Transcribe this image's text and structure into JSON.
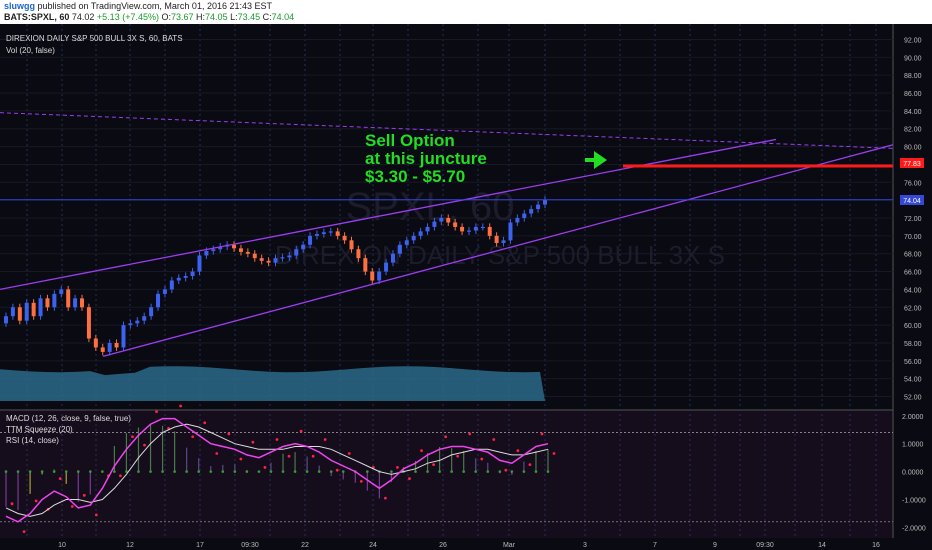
{
  "header": {
    "username": "sluwgg",
    "published_text": "published on TradingView.com, March 01, 2016 21:43 EST",
    "symbol_interval": "BATS:SPXL, 60",
    "last": "74.02",
    "change": "+5.13 (+7.45%)",
    "open_label": "O:",
    "open": "73.67",
    "high_label": "H:",
    "high": "74.05",
    "low_label": "L:",
    "low": "73.45",
    "close_label": "C:",
    "close": "74.04"
  },
  "chart_labels": {
    "title": "DIREXION DAILY S&P 500 BULL 3X S, 60, BATS",
    "volume": "Vol (20, false)",
    "watermark_symbol": "SPXL, 60",
    "watermark_name": "DIREXION DAILY S&P 500 BULL 3X S",
    "macd": "MACD (12, 26, close, 9, false, true)",
    "squeeze": "TTM Squeeze (20)",
    "rsi": "RSI (14, close)",
    "current_price": "74.04",
    "target_price": "77.83"
  },
  "annotation": {
    "line1": "Sell Option",
    "line2": "at this juncture",
    "line3": "$3.30 - $5.70",
    "color": "#22dd22"
  },
  "colors": {
    "background": "#0a0a12",
    "up_candle": "#3e62f0",
    "down_candle": "#ff7040",
    "channel": "#9b3ef0",
    "target": "#ff1a1a",
    "macd": "#ee44ee",
    "signal": "#dddddd",
    "dots": "#ff2244",
    "volume": "#2a6a8a"
  },
  "chart_data": [
    {
      "type": "candlestick",
      "title": "DIREXION DAILY S&P 500 BULL 3X S, 60, BATS",
      "y_ticks": [
        "52.00",
        "54.00",
        "56.00",
        "58.00",
        "60.00",
        "62.00",
        "64.00",
        "66.00",
        "68.00",
        "70.00",
        "72.00",
        "74.00",
        "76.00",
        "78.00",
        "80.00",
        "82.00",
        "84.00",
        "86.00",
        "88.00",
        "90.00",
        "92.00"
      ],
      "ylim": [
        51.5,
        92.5
      ],
      "x_ticks": [
        "10",
        "12",
        "17",
        "09:30",
        "22",
        "24",
        "26",
        "Mar",
        "3",
        "7",
        "9",
        "09:30",
        "14",
        "16"
      ],
      "close_series": [
        61.0,
        62.0,
        60.5,
        62.5,
        61.0,
        63.0,
        62.0,
        63.5,
        64.0,
        62.0,
        63.0,
        62.0,
        58.5,
        57.5,
        57.0,
        58.0,
        57.5,
        60.0,
        60.2,
        60.5,
        61.0,
        62.0,
        63.5,
        64.0,
        65.0,
        65.3,
        65.5,
        66.0,
        67.8,
        68.3,
        68.5,
        68.8,
        69.0,
        68.6,
        68.2,
        68.0,
        67.5,
        67.2,
        67.0,
        67.5,
        67.6,
        67.8,
        68.5,
        69.0,
        70.0,
        70.2,
        70.4,
        70.5,
        70.0,
        69.5,
        68.5,
        67.5,
        66.0,
        65.0,
        66.0,
        67.0,
        68.0,
        69.0,
        69.5,
        70.0,
        70.5,
        71.0,
        71.6,
        72.0,
        71.5,
        71.0,
        70.5,
        70.6,
        71.0,
        71.0,
        70.0,
        69.2,
        69.5,
        71.5,
        72.0,
        72.5,
        73.0,
        73.5,
        74.04
      ],
      "volume_area_range": [
        51.5,
        55.4
      ],
      "channel_upper": {
        "from": {
          "x": "8 Feb",
          "y": 64.0
        },
        "to": {
          "x": "10 Mar",
          "y": 80.8
        }
      },
      "channel_lower": {
        "from": {
          "x": "11 Feb",
          "y": 56.5
        },
        "to": {
          "x": "16 Mar",
          "y": 80.2
        }
      },
      "dashed_resistance": {
        "from": 83.8,
        "to": 79.8
      },
      "current_price_line": 74.04,
      "target_line": {
        "value": 77.83,
        "from_x": "4 Mar"
      }
    },
    {
      "type": "line",
      "title": "MACD (12, 26, close, 9, false, true)",
      "y_ticks": [
        "2.0000",
        "1.0000",
        "0.0000",
        "-1.0000",
        "-2.0000"
      ],
      "ylim": [
        -2.2,
        2.1
      ],
      "upper_level": 1.4,
      "lower_level": -1.8,
      "series": [
        {
          "name": "MACD",
          "values": [
            -1.6,
            -1.8,
            -1.5,
            -1.0,
            -0.7,
            -0.9,
            -1.3,
            -1.2,
            -0.6,
            0.2,
            0.8,
            1.3,
            1.7,
            1.9,
            1.9,
            1.6,
            1.3,
            1.0,
            0.9,
            0.8,
            0.6,
            0.5,
            0.7,
            0.9,
            1.0,
            0.9,
            0.7,
            0.4,
            0.2,
            0.0,
            -0.3,
            -0.6,
            -0.3,
            0.1,
            0.3,
            0.6,
            0.8,
            0.9,
            0.9,
            0.8,
            0.7,
            0.4,
            0.3,
            0.6,
            0.9,
            1.0
          ]
        },
        {
          "name": "Signal",
          "values": [
            -1.3,
            -1.5,
            -1.6,
            -1.5,
            -1.2,
            -1.0,
            -1.0,
            -1.1,
            -1.0,
            -0.6,
            -0.1,
            0.5,
            1.0,
            1.4,
            1.6,
            1.7,
            1.6,
            1.4,
            1.2,
            1.0,
            0.9,
            0.8,
            0.8,
            0.8,
            0.9,
            0.9,
            0.9,
            0.8,
            0.6,
            0.4,
            0.2,
            0.0,
            -0.1,
            0.0,
            0.1,
            0.3,
            0.4,
            0.6,
            0.7,
            0.8,
            0.8,
            0.7,
            0.6,
            0.6,
            0.7,
            0.8
          ]
        }
      ]
    }
  ]
}
